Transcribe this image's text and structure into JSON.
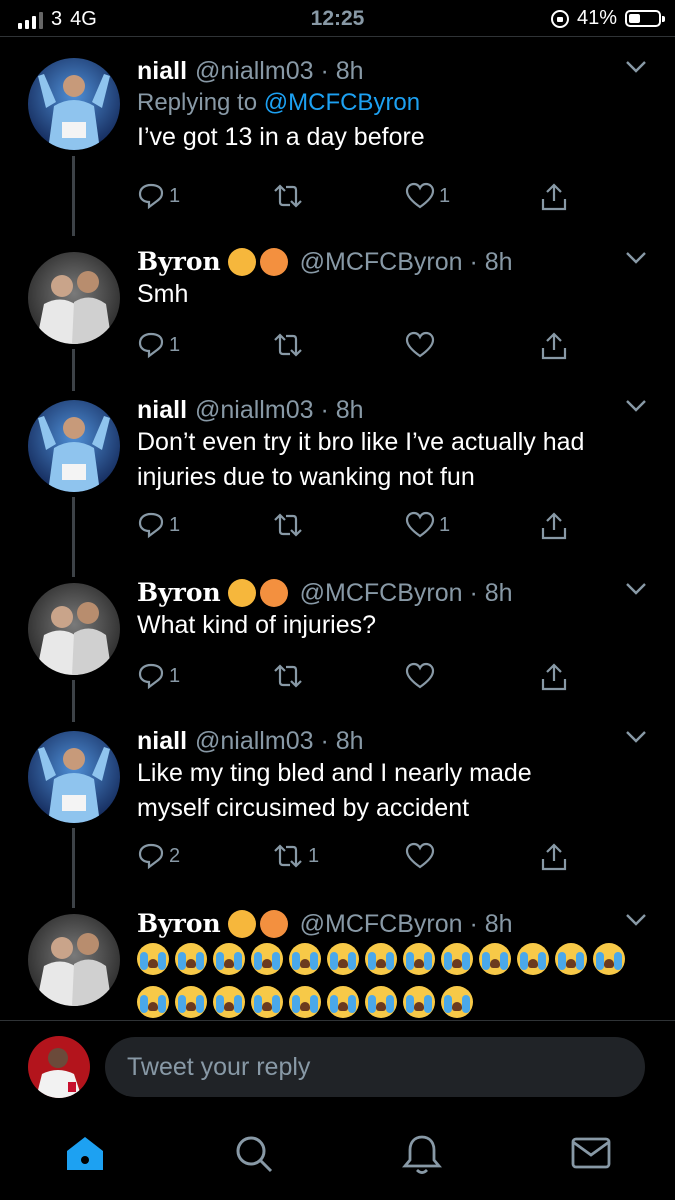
{
  "status": {
    "carrier": "3",
    "network": "4G",
    "time": "12:25",
    "battery": "41%",
    "battery_level": 0.41
  },
  "tweets": [
    {
      "name": "niall",
      "handle": "@niallm03",
      "time": "8h",
      "reply_prefix": "Replying to",
      "reply_to": "@MCFCByron",
      "lines": [
        "I’ve got 13 in a day before"
      ],
      "replies": "1",
      "retweets": "",
      "likes": "1"
    },
    {
      "name": "Byron",
      "handle": "@MCFCByron",
      "time": "8h",
      "lines": [
        "Smh"
      ],
      "replies": "1",
      "retweets": "",
      "likes": ""
    },
    {
      "name": "niall",
      "handle": "@niallm03",
      "time": "8h",
      "lines": [
        "Don’t even try it bro like I’ve actually had",
        "injuries due to wanking not fun"
      ],
      "replies": "1",
      "retweets": "",
      "likes": "1"
    },
    {
      "name": "Byron",
      "handle": "@MCFCByron",
      "time": "8h",
      "lines": [
        "What kind of injuries?"
      ],
      "replies": "1",
      "retweets": "",
      "likes": ""
    },
    {
      "name": "niall",
      "handle": "@niallm03",
      "time": "8h",
      "lines": [
        "Like my ting bled and I nearly made",
        "myself circusimed by accident"
      ],
      "replies": "2",
      "retweets": "1",
      "likes": ""
    },
    {
      "name": "Byron",
      "handle": "@MCFCByron",
      "time": "8h",
      "cry_emoji_rows": [
        13,
        9
      ]
    }
  ],
  "compose": {
    "placeholder": "Tweet your reply"
  },
  "colors": {
    "accent": "#1da1f2",
    "muted": "#8899a6",
    "background": "#000000",
    "input_bg": "#202327"
  },
  "icons": [
    "reply-icon",
    "retweet-icon",
    "like-icon",
    "share-icon",
    "chevron-down-icon",
    "home-icon",
    "search-icon",
    "notifications-icon",
    "messages-icon"
  ]
}
